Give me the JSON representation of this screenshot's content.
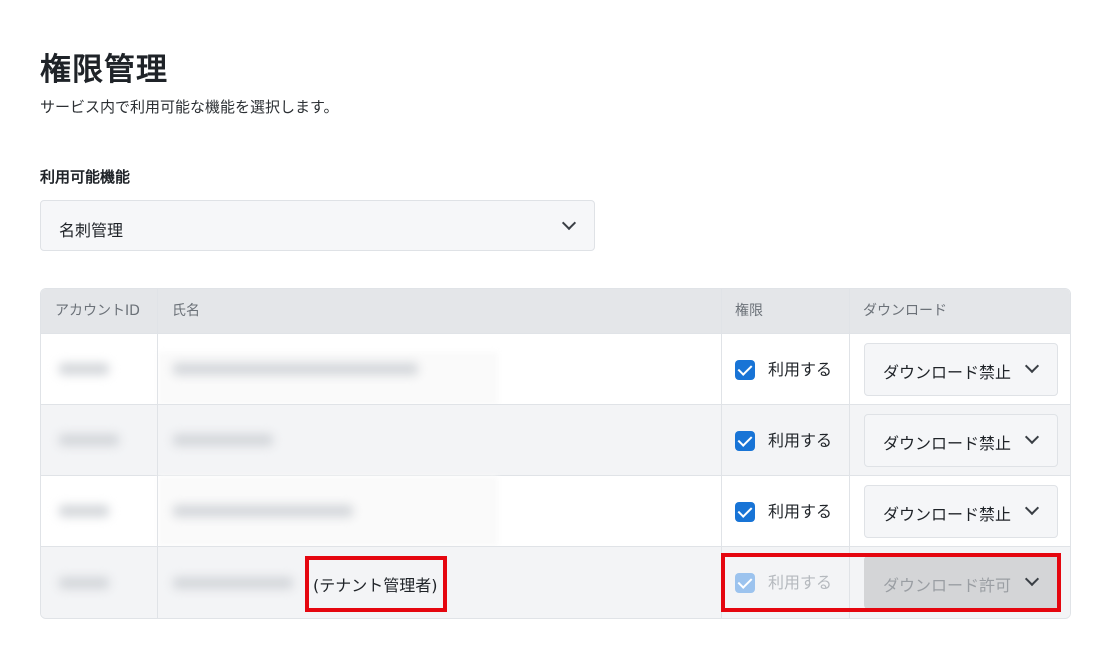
{
  "page": {
    "title": "権限管理",
    "description": "サービス内で利用可能な機能を選択します。"
  },
  "feature_field": {
    "label": "利用可能機能",
    "selected": "名刺管理"
  },
  "table": {
    "headers": {
      "account_id": "アカウントID",
      "name": "氏名",
      "permission": "権限",
      "download": "ダウンロード"
    },
    "rows": [
      {
        "permission_label": "利用する",
        "permission_checked": true,
        "download_value": "ダウンロード禁止"
      },
      {
        "permission_label": "利用する",
        "permission_checked": true,
        "download_value": "ダウンロード禁止"
      },
      {
        "permission_label": "利用する",
        "permission_checked": true,
        "download_value": "ダウンロード禁止"
      },
      {
        "admin_note": "(テナント管理者)",
        "permission_label": "利用する",
        "permission_checked": true,
        "permission_disabled": true,
        "download_value": "ダウンロード許可",
        "download_disabled": true
      }
    ]
  },
  "colors": {
    "accent": "#1874d6",
    "highlight": "#e5060f",
    "header_bg": "#e4e6e9"
  },
  "icons": {
    "select_chevron": "chevron-down-icon",
    "checkbox": "checkbox-checked-icon"
  }
}
